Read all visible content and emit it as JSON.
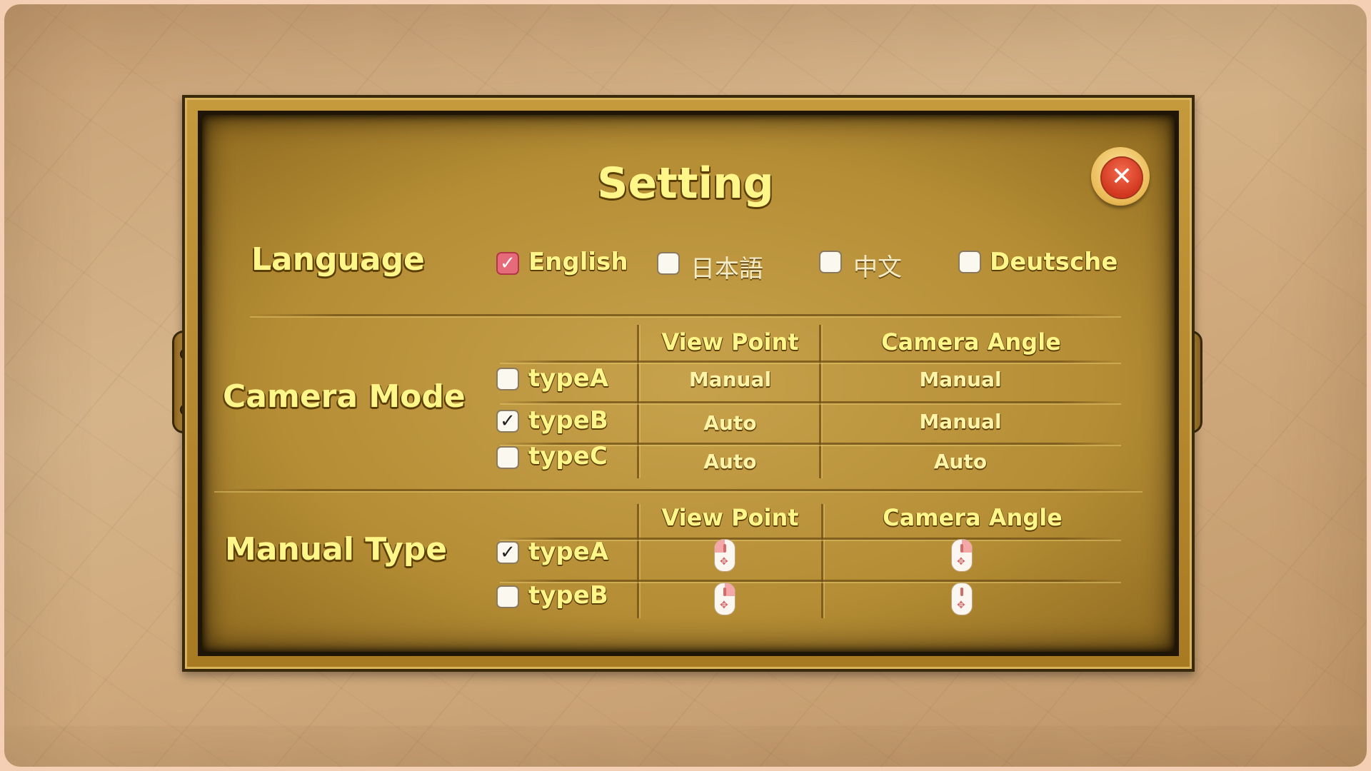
{
  "title": "Setting",
  "close_button": {
    "glyph": "✕"
  },
  "language": {
    "label": "Language",
    "options": [
      {
        "label": "English",
        "checked": true
      },
      {
        "label": "日本語",
        "checked": false
      },
      {
        "label": "中文",
        "checked": false
      },
      {
        "label": "Deutsche",
        "checked": false
      }
    ]
  },
  "camera_mode": {
    "label": "Camera Mode",
    "headers": {
      "view_point": "View Point",
      "camera_angle": "Camera Angle"
    },
    "rows": [
      {
        "type": "typeA",
        "checked": false,
        "view_point": "Manual",
        "camera_angle": "Manual"
      },
      {
        "type": "typeB",
        "checked": true,
        "view_point": "Auto",
        "camera_angle": "Manual"
      },
      {
        "type": "typeC",
        "checked": false,
        "view_point": "Auto",
        "camera_angle": "Auto"
      }
    ]
  },
  "manual_type": {
    "label": "Manual Type",
    "headers": {
      "view_point": "View Point",
      "camera_angle": "Camera Angle"
    },
    "rows": [
      {
        "type": "typeA",
        "checked": true,
        "view_point_icon": "mouse-left-drag-icon",
        "camera_angle_icon": "mouse-right-drag-icon"
      },
      {
        "type": "typeB",
        "checked": false,
        "view_point_icon": "mouse-right-drag-icon",
        "camera_angle_icon": "mouse-wheel-drag-icon"
      }
    ]
  },
  "check_glyph": "✓",
  "colors": {
    "title_yellow": "#fff68a",
    "panel_gold": "#b58d35",
    "close_red": "#d2381f",
    "checked_red": "#e56b7b"
  }
}
